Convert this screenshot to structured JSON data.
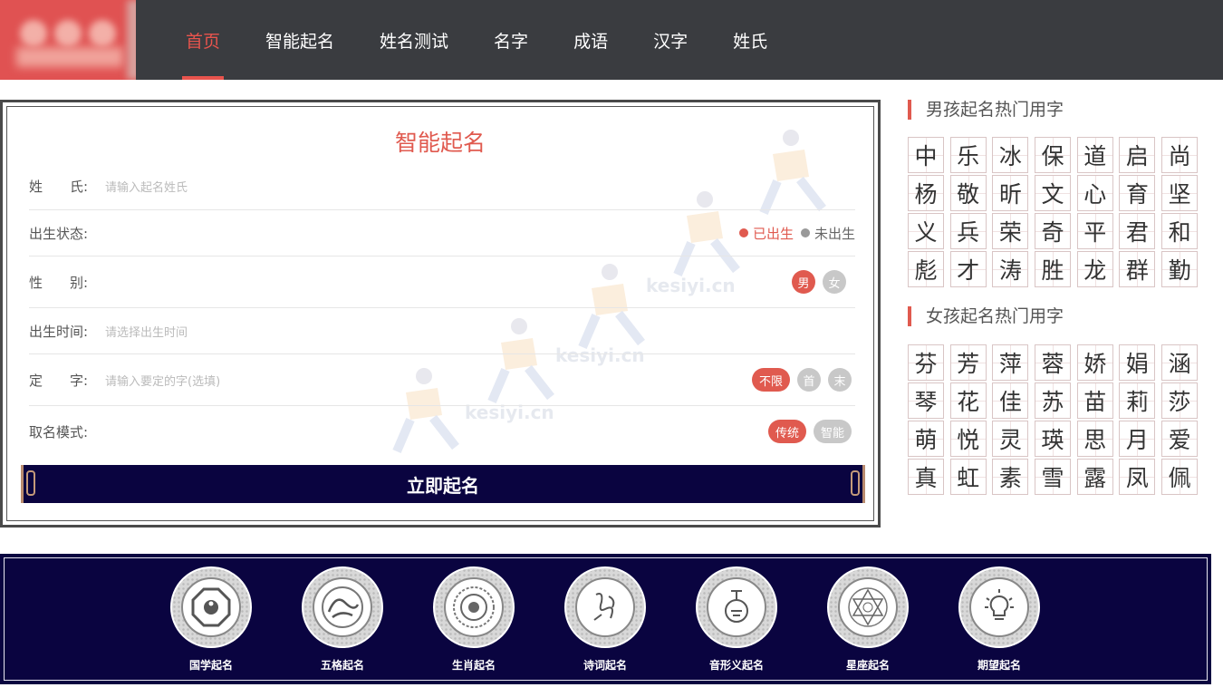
{
  "nav": {
    "items": [
      {
        "label": "首页",
        "active": true
      },
      {
        "label": "智能起名"
      },
      {
        "label": "姓名测试"
      },
      {
        "label": "名字"
      },
      {
        "label": "成语"
      },
      {
        "label": "汉字"
      },
      {
        "label": "姓氏"
      }
    ]
  },
  "form": {
    "title": "智能起名",
    "surname": {
      "label": "姓　　氏:",
      "placeholder": "请输入起名姓氏"
    },
    "birth_status": {
      "label": "出生状态:",
      "options": [
        "已出生",
        "未出生"
      ],
      "selected": "已出生"
    },
    "gender": {
      "label": "性　　别:",
      "options": [
        "男",
        "女"
      ],
      "selected": "男"
    },
    "birth_time": {
      "label": "出生时间:",
      "placeholder": "请选择出生时间"
    },
    "fixed_char": {
      "label": "定　　字:",
      "placeholder": "请输入要定的字(选填)",
      "options": [
        "不限",
        "首",
        "末"
      ],
      "selected": "不限"
    },
    "mode": {
      "label": "取名模式:",
      "options": [
        "传统",
        "智能"
      ],
      "selected": "传统"
    },
    "submit_label": "立即起名",
    "watermark": "kesiyi.cn"
  },
  "sidebar": {
    "boy_title": "男孩起名热门用字",
    "boy_chars": [
      "中",
      "乐",
      "冰",
      "保",
      "道",
      "启",
      "尚",
      "杨",
      "敬",
      "昕",
      "文",
      "心",
      "育",
      "坚",
      "义",
      "兵",
      "荣",
      "奇",
      "平",
      "君",
      "和",
      "彪",
      "才",
      "涛",
      "胜",
      "龙",
      "群",
      "勤"
    ],
    "girl_title": "女孩起名热门用字",
    "girl_chars": [
      "芬",
      "芳",
      "萍",
      "蓉",
      "娇",
      "娟",
      "涵",
      "琴",
      "花",
      "佳",
      "苏",
      "苗",
      "莉",
      "莎",
      "萌",
      "悦",
      "灵",
      "瑛",
      "思",
      "月",
      "爱",
      "真",
      "虹",
      "素",
      "雪",
      "露",
      "凤",
      "佩"
    ]
  },
  "categories": [
    {
      "label": "国学起名",
      "icon": "bagua-icon"
    },
    {
      "label": "五格起名",
      "icon": "dragon-icon"
    },
    {
      "label": "生肖起名",
      "icon": "zodiac-wheel-icon"
    },
    {
      "label": "诗词起名",
      "icon": "calligraphy-icon"
    },
    {
      "label": "音形义起名",
      "icon": "instrument-icon"
    },
    {
      "label": "星座起名",
      "icon": "star-mandala-icon"
    },
    {
      "label": "期望起名",
      "icon": "lightbulb-icon"
    }
  ],
  "colors": {
    "accent": "#e05a4f",
    "header_bg": "#3a3c40",
    "navy": "#0a0440"
  }
}
